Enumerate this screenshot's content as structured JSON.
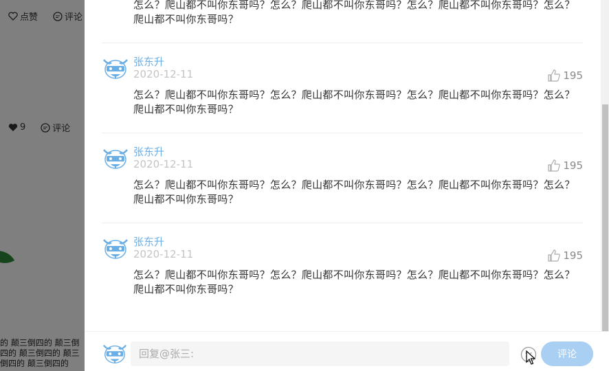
{
  "background": {
    "row1": {
      "like_label": "点赞",
      "comment_label": "评论"
    },
    "row2": {
      "like_count": "9",
      "comment_label": "评论"
    },
    "snippet": "的 颠三倒四的 颠三倒四的 颠三倒四的 颠三倒四的 颠三倒四的"
  },
  "comments": [
    {
      "text": "怎么？爬山都不叫你东哥吗？怎么？爬山都不叫你东哥吗？怎么？爬山都不叫你东哥吗？怎么？爬山都不叫你东哥吗？"
    },
    {
      "name": "张东升",
      "date": "2020-12-11",
      "likes": "195",
      "text": "怎么？爬山都不叫你东哥吗？怎么？爬山都不叫你东哥吗？怎么？爬山都不叫你东哥吗？怎么？爬山都不叫你东哥吗？"
    },
    {
      "name": "张东升",
      "date": "2020-12-11",
      "likes": "195",
      "text": "怎么？爬山都不叫你东哥吗？怎么？爬山都不叫你东哥吗？怎么？爬山都不叫你东哥吗？怎么？爬山都不叫你东哥吗？"
    },
    {
      "name": "张东升",
      "date": "2020-12-11",
      "likes": "195",
      "text": "怎么？爬山都不叫你东哥吗？怎么？爬山都不叫你东哥吗？怎么？爬山都不叫你东哥吗？怎么？爬山都不叫你东哥吗？"
    }
  ],
  "reply": {
    "placeholder": "回复@张三:",
    "submit_label": "评论"
  },
  "colors": {
    "accent": "#6aaee6",
    "submit_bg": "#a9cff2",
    "date": "#c4c4c4"
  },
  "icons": {
    "avatar": "cow-avatar-icon",
    "like": "thumbs-up-icon",
    "emoji": "smiley-icon",
    "bg_like": "heart-icon",
    "bg_comment": "comment-icon"
  }
}
